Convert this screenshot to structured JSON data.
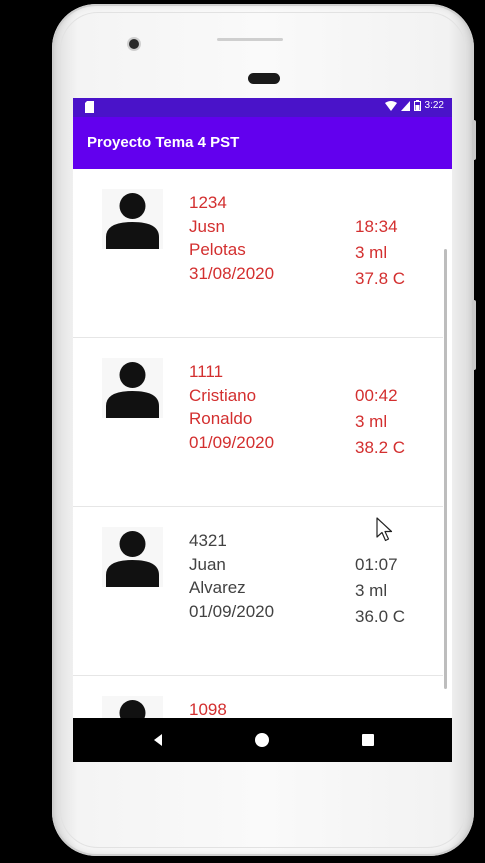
{
  "status_bar": {
    "time": "3:22"
  },
  "app_bar": {
    "title": "Proyecto Tema 4 PST"
  },
  "records": [
    {
      "id": "1234",
      "first_name": "Jusn",
      "last_name": "Pelotas",
      "date": "31/08/2020",
      "time": "18:34",
      "volume": "3 ml",
      "temperature": "37.8 C",
      "highlight": "red"
    },
    {
      "id": "1111",
      "first_name": "Cristiano",
      "last_name": "Ronaldo",
      "date": "01/09/2020",
      "time": "00:42",
      "volume": "3 ml",
      "temperature": "38.2 C",
      "highlight": "red"
    },
    {
      "id": "4321",
      "first_name": "Juan",
      "last_name": "Alvarez",
      "date": "01/09/2020",
      "time": "01:07",
      "volume": "3 ml",
      "temperature": "36.0 C",
      "highlight": "gray"
    },
    {
      "id": "1098",
      "highlight": "red"
    }
  ],
  "icons": {
    "avatar": "person-icon",
    "nav_back": "back-triangle-icon",
    "nav_home": "home-circle-icon",
    "nav_recent": "recents-square-icon"
  },
  "colors": {
    "status_bar": "#4a13c9",
    "app_bar": "#6200ee",
    "text_red": "#d32f2f",
    "text_gray": "#424242"
  }
}
